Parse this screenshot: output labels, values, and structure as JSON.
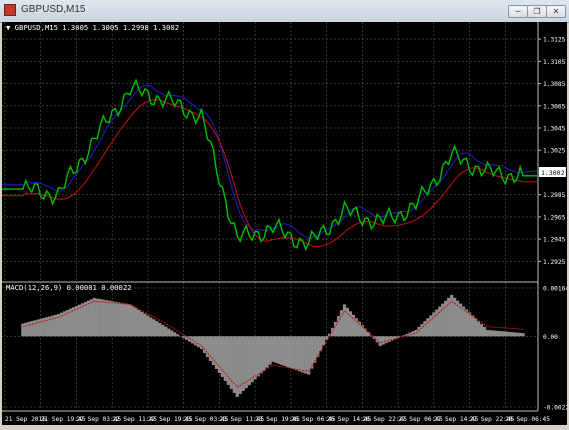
{
  "window": {
    "title": "GBPUSD,M15",
    "controls": {
      "minimize": "─",
      "restore": "❐",
      "close": "✕"
    }
  },
  "colors": {
    "background": "#000000",
    "grid": "#5a5a5a",
    "price_line": "#00c000",
    "ma_blue": "#2020c8",
    "ma_red": "#c81010",
    "macd_hist": "#8c8c8c",
    "macd_signal": "#c81010",
    "text": "#ffffff",
    "price_tag_bg": "#ffffff",
    "price_tag_text": "#000000"
  },
  "header": {
    "symbol_line": "▼ GBPUSD,M15  1.3005 1.3005 1.2998 1.3002"
  },
  "price_panel": {
    "current_price_label": "1.3002",
    "y_ticks": [
      "1.3125",
      "1.3105",
      "1.3085",
      "1.3065",
      "1.3045",
      "1.3025",
      "1.3002",
      "1.2985",
      "1.2965",
      "1.2945",
      "1.2925"
    ]
  },
  "macd_panel": {
    "title": "MACD(12,26,9) 0.00001 0.00022",
    "y_ticks": [
      "0.00164",
      "0.00",
      "-0.00228"
    ]
  },
  "time_axis": {
    "labels": [
      "21 Sep 2016",
      "21 Sep 19:45",
      "22 Sep 03:45",
      "22 Sep 11:45",
      "22 Sep 19:45",
      "23 Sep 03:45",
      "23 Sep 11:45",
      "23 Sep 19:45",
      "26 Sep 06:45",
      "26 Sep 14:45",
      "26 Sep 22:45",
      "27 Sep 06:45",
      "27 Sep 14:45",
      "27 Sep 22:45",
      "28 Sep 06:45"
    ]
  },
  "chart_data": {
    "type": "line",
    "symbol": "GBPUSD",
    "timeframe": "M15",
    "ylim": [
      1.291,
      1.3135
    ],
    "x": [
      "21 Sep 2016",
      "21 Sep 19:45",
      "22 Sep 03:45",
      "22 Sep 11:45",
      "22 Sep 19:45",
      "23 Sep 03:45",
      "23 Sep 11:45",
      "23 Sep 19:45",
      "26 Sep 06:45",
      "26 Sep 14:45",
      "26 Sep 22:45",
      "27 Sep 06:45",
      "27 Sep 14:45",
      "27 Sep 22:45",
      "28 Sep 06:45"
    ],
    "series": [
      {
        "values": [
          1.299,
          1.2985,
          1.3035,
          1.308,
          1.307,
          1.3055,
          1.2945,
          1.2955,
          1.294,
          1.297,
          1.296,
          1.2975,
          1.302,
          1.3005,
          1.3002
        ]
      }
    ],
    "macd": {
      "ylim": [
        -0.00228,
        0.00164
      ],
      "histogram": [
        0.0004,
        0.0007,
        0.0012,
        0.001,
        0.0003,
        -0.0004,
        -0.0019,
        -0.0008,
        -0.0012,
        0.001,
        -0.0003,
        0.0002,
        0.0013,
        0.0002,
        0.0001
      ],
      "signal": [
        0.0003,
        0.0006,
        0.0011,
        0.001,
        0.0004,
        -0.0003,
        -0.0016,
        -0.0009,
        -0.0011,
        0.0008,
        -0.0002,
        0.0001,
        0.0011,
        0.0003,
        0.00022
      ]
    }
  }
}
